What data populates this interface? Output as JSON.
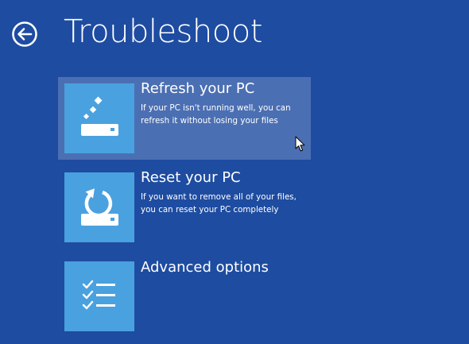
{
  "header": {
    "back_icon": "back-arrow-circle-icon",
    "title": "Troubleshoot"
  },
  "options": [
    {
      "title": "Refresh your PC",
      "description_lines": [
        "If your PC isn't running well, you can",
        "refresh it without losing your files"
      ],
      "icon": "refresh-pc-icon",
      "selected": true
    },
    {
      "title": "Reset your PC",
      "description_lines": [
        "If you want to remove all of your files,",
        "you can reset your PC completely"
      ],
      "icon": "reset-pc-icon",
      "selected": false
    },
    {
      "title": "Advanced options",
      "description_lines": [],
      "icon": "checklist-icon",
      "selected": false
    }
  ],
  "colors": {
    "background": "#1e4ca1",
    "tile": "#4aa1df",
    "text": "#ffffff",
    "selection": "rgba(255,255,255,0.2)"
  }
}
